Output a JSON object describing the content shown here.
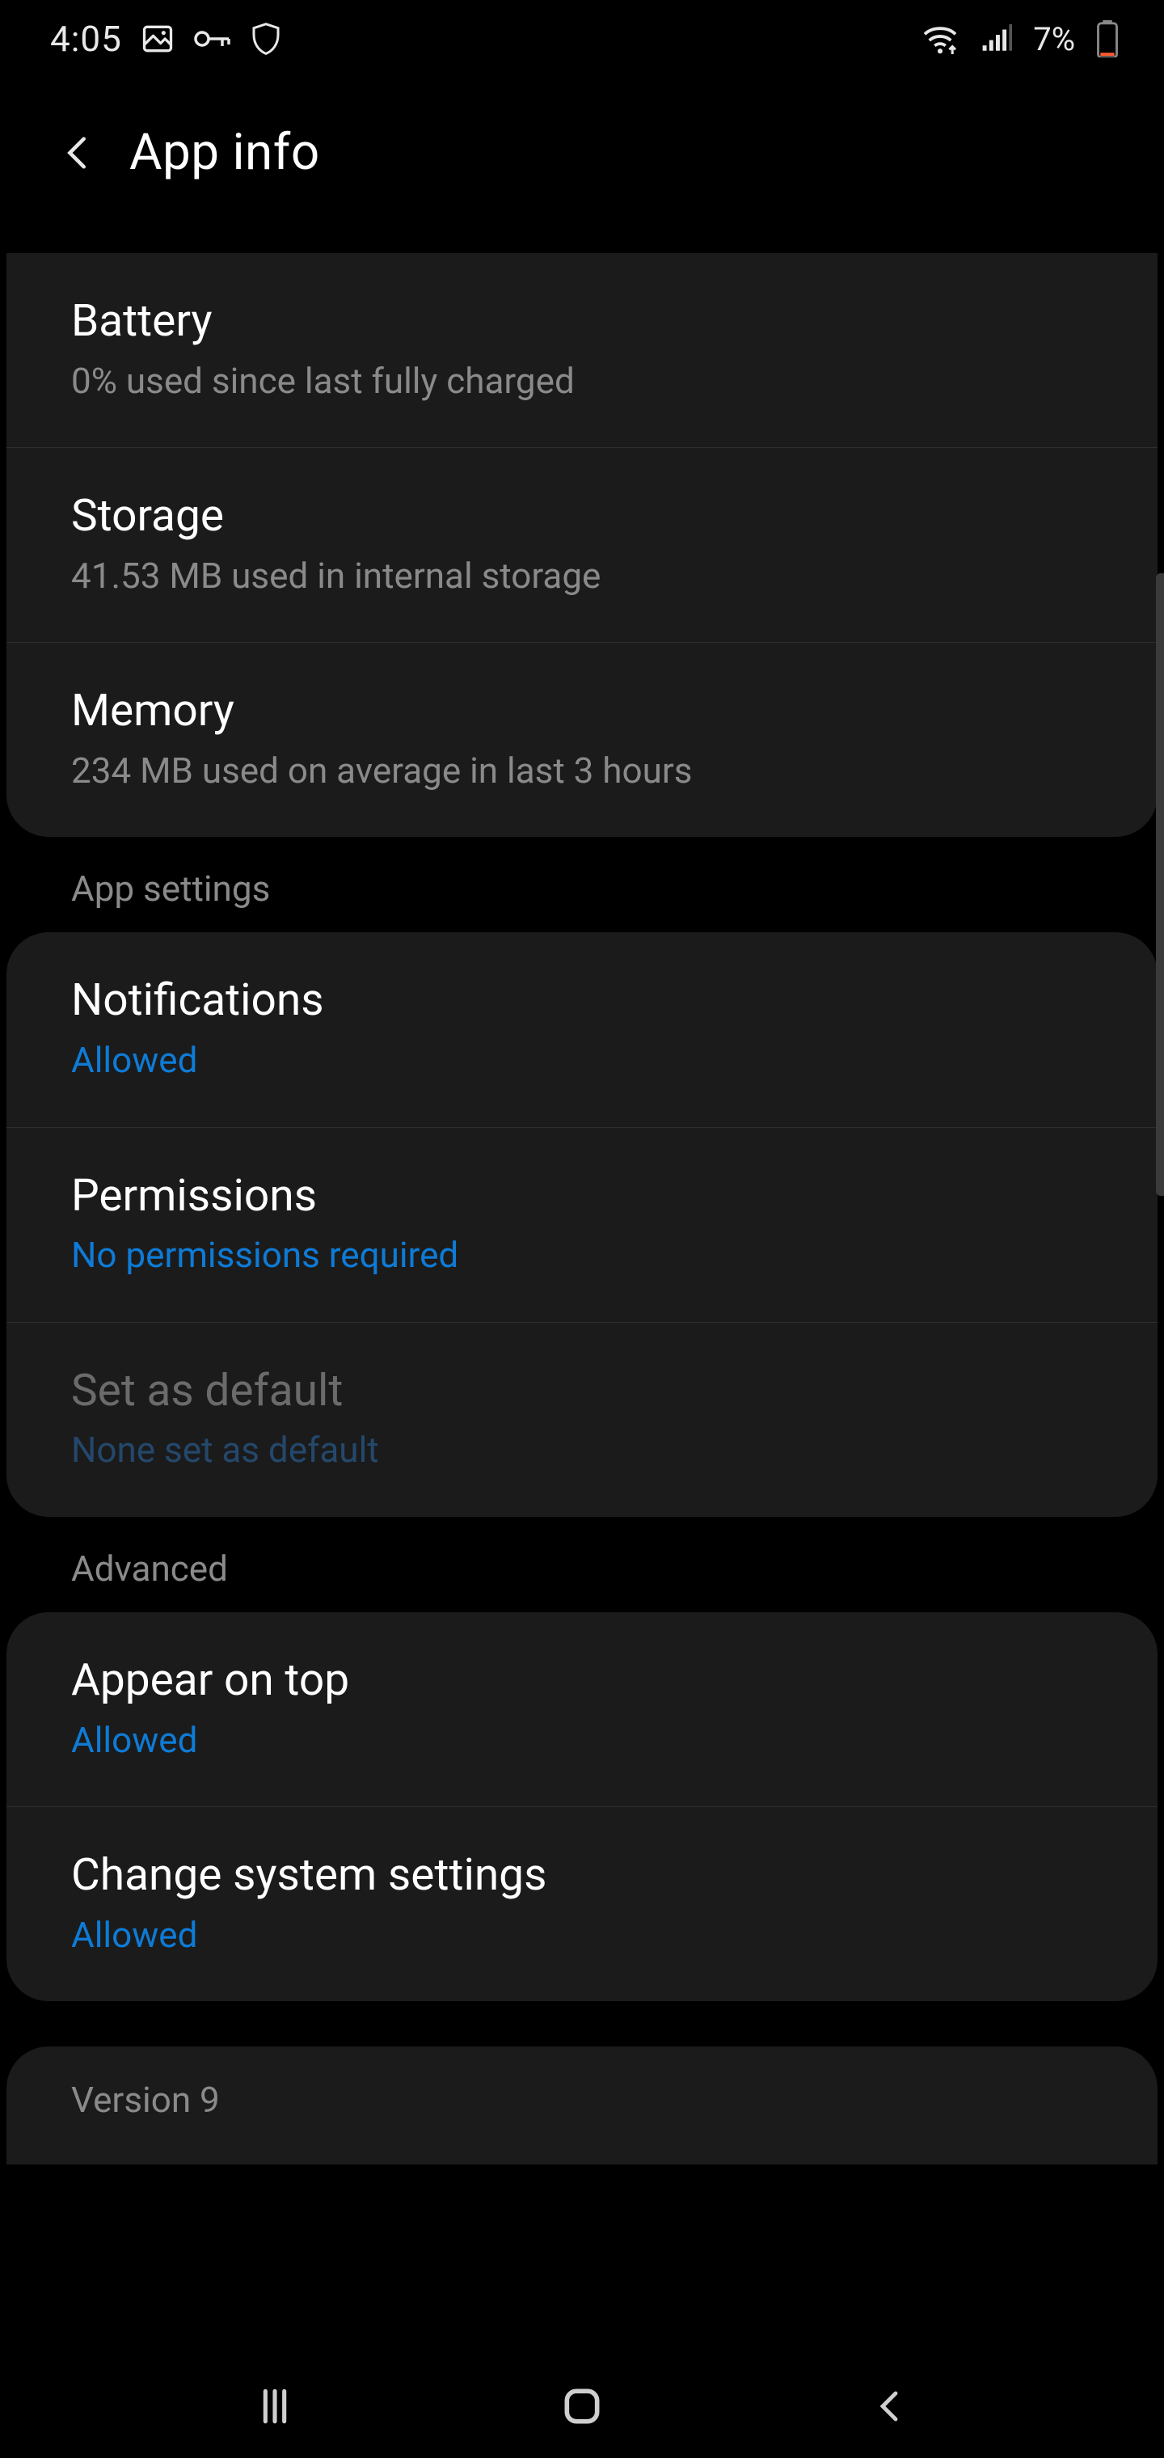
{
  "statusbar": {
    "time": "4:05",
    "battery": "7%"
  },
  "header": {
    "title": "App info"
  },
  "usage": {
    "battery": {
      "label": "Battery",
      "sub": "0% used since last fully charged"
    },
    "storage": {
      "label": "Storage",
      "sub": "41.53 MB used in internal storage"
    },
    "memory": {
      "label": "Memory",
      "sub": "234 MB used on average in last 3 hours"
    }
  },
  "app_settings": {
    "section": "App settings",
    "notifications": {
      "label": "Notifications",
      "sub": "Allowed"
    },
    "permissions": {
      "label": "Permissions",
      "sub": "No permissions required"
    },
    "default": {
      "label": "Set as default",
      "sub": "None set as default"
    }
  },
  "advanced": {
    "section": "Advanced",
    "appear_on_top": {
      "label": "Appear on top",
      "sub": "Allowed"
    },
    "change_settings": {
      "label": "Change system settings",
      "sub": "Allowed"
    }
  },
  "version": {
    "text": "Version 9"
  }
}
